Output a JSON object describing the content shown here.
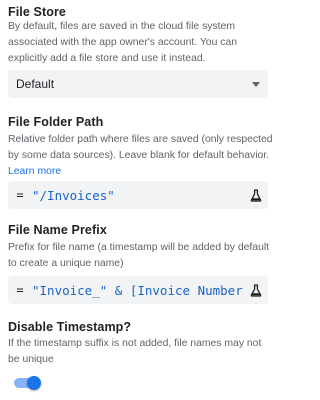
{
  "file_store": {
    "title": "File Store",
    "description": "By default, files are saved in the cloud file system associated with the app owner's account. You can explicitly add a file store and use it instead.",
    "select_value": "Default"
  },
  "file_folder_path": {
    "title": "File Folder Path",
    "description": "Relative folder path where files are saved (only respected by some data sources). Leave blank for default behavior.",
    "learn_more": "Learn more",
    "equals": "=",
    "expression": "\"/Invoices\""
  },
  "file_name_prefix": {
    "title": "File Name Prefix",
    "description": "Prefix for file name (a timestamp will be added by default to create a unique name)",
    "equals": "=",
    "expression": "\"Invoice_\" & [Invoice Number"
  },
  "disable_timestamp": {
    "title": "Disable Timestamp?",
    "description": "If the timestamp suffix is not added, file names may not be unique",
    "enabled": true
  },
  "colors": {
    "accent": "#1a73e8",
    "code_text": "#1a63c8",
    "field_bg": "#f1f3f4"
  },
  "icons": {
    "expression_assistant": "flask-icon",
    "dropdown": "chevron-down-icon"
  }
}
